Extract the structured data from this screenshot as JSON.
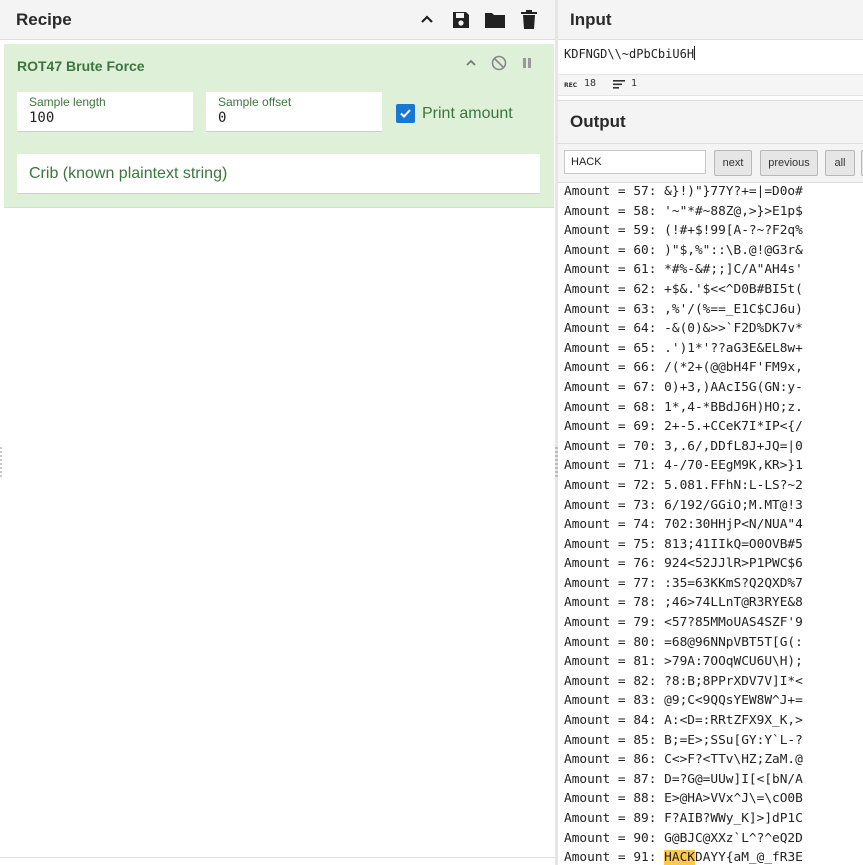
{
  "recipe": {
    "title": "Recipe",
    "operation": {
      "name": "ROT47 Brute Force",
      "sample_length": {
        "label": "Sample length",
        "value": "100"
      },
      "sample_offset": {
        "label": "Sample offset",
        "value": "0"
      },
      "print_amount": {
        "label": "Print amount",
        "checked": true
      },
      "crib": {
        "placeholder": "Crib (known plaintext string)",
        "value": ""
      }
    }
  },
  "input": {
    "title": "Input",
    "text": "KDFNGD\\\\~dPbCbiU6H",
    "status": {
      "length": "18",
      "lines": "1"
    }
  },
  "output": {
    "title": "Output",
    "search": {
      "value": "HACK",
      "next_label": "next",
      "previous_label": "previous",
      "all_label": "all"
    },
    "lines": [
      "Amount = 57: &}!)\"}77Y?+=|=D0o#",
      "Amount = 58: '~\"*#~88Z@,>}>E1p$",
      "Amount = 59: (!#+$!99[A-?~?F2q%",
      "Amount = 60: )\"$,%\"::\\B.@!@G3r&",
      "Amount = 61: *#%-&#;;]C/A\"AH4s'",
      "Amount = 62: +$&.'$<<^D0B#BI5t(",
      "Amount = 63: ,%'/(%==_E1C$CJ6u)",
      "Amount = 64: -&(0)&>>`F2D%DK7v*",
      "Amount = 65: .')1*'??aG3E&EL8w+",
      "Amount = 66: /(*2+(@@bH4F'FM9x,",
      "Amount = 67: 0)+3,)AAcI5G(GN:y-",
      "Amount = 68: 1*,4-*BBdJ6H)HO;z.",
      "Amount = 69: 2+-5.+CCeK7I*IP<{/",
      "Amount = 70: 3,.6/,DDfL8J+JQ=|0",
      "Amount = 71: 4-/70-EEgM9K,KR>}1",
      "Amount = 72: 5.081.FFhN:L-LS?~2",
      "Amount = 73: 6/192/GGiO;M.MT@!3",
      "Amount = 74: 702:30HHjP<N/NUA\"4",
      "Amount = 75: 813;41IIkQ=O0OVB#5",
      "Amount = 76: 924<52JJlR>P1PWC$6",
      "Amount = 77: :35=63KKmS?Q2QXD%7",
      "Amount = 78: ;46>74LLnT@R3RYE&8",
      "Amount = 79: <57?85MMoUAS4SZF'9",
      "Amount = 80: =68@96NNpVBT5T[G(:",
      "Amount = 81: >79A:7OOqWCU6U\\H);",
      "Amount = 82: ?8:B;8PPrXDV7V]I*<",
      "Amount = 83: @9;C<9QQsYEW8W^J+=",
      "Amount = 84: A:<D=:RRtZFX9X_K,>",
      "Amount = 85: B;=E>;SSu[GY:Y`L-?",
      "Amount = 86: C<>F?<TTv\\HZ;ZaM.@",
      "Amount = 87: D=?G@=UUw]I[<[bN/A",
      "Amount = 88: E>@HA>VVx^J\\=\\cO0B",
      "Amount = 89: F?AIB?WWy_K]>]dP1C",
      "Amount = 90: G@BJC@XXz`L^?^eQ2D",
      "Amount = 91: HACKDAYY{aM_@_fR3E"
    ],
    "highlight": {
      "line_index": 34,
      "text": "HACK"
    }
  },
  "colors": {
    "accent": "#1976d2",
    "operation_bg": "#dff0d8",
    "operation_text": "#3c763d",
    "highlight": "#fcc94a"
  },
  "icons": [
    "chevron-up-icon",
    "save-icon",
    "folder-icon",
    "trash-icon",
    "disable-icon",
    "pause-icon",
    "checkmark-icon",
    "length-icon",
    "lines-icon"
  ]
}
